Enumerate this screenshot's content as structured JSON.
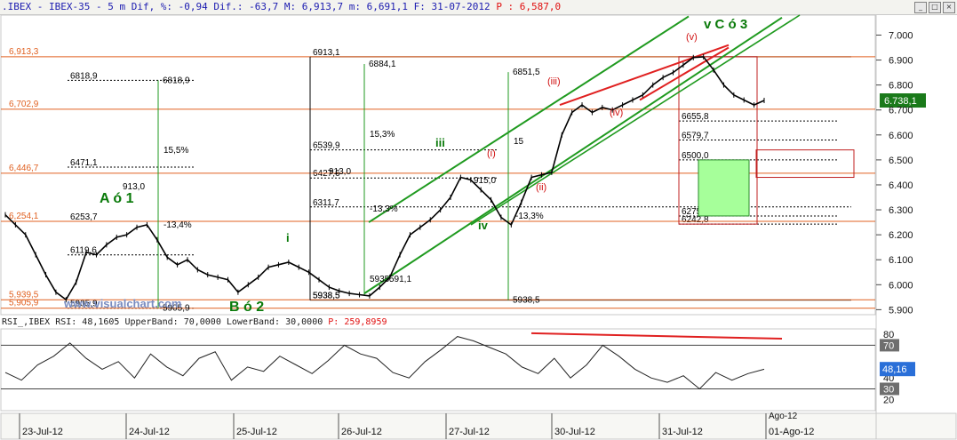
{
  "header": {
    "title": ".IBEX - IBEX-35 - 5 m Dif, %: -0,94 Dif.: -63,7 M: 6,913,7 m: 6,691,1 F: 31-07-2012",
    "price_label": "P : 6,587,0",
    "buttons": [
      "_",
      "□",
      "×"
    ]
  },
  "chart_data": [
    {
      "type": "line",
      "title": "IBEX-35 5 m",
      "x": [
        "23-Jul-12",
        "24-Jul-12",
        "25-Jul-12",
        "26-Jul-12",
        "27-Jul-12",
        "30-Jul-12",
        "31-Jul-12",
        "01-Ago-12"
      ],
      "ylim": [
        5880,
        7080
      ],
      "y_ticks": [
        "7.000",
        "6.900",
        "6.800",
        "6.700",
        "6.600",
        "6.500",
        "6.400",
        "6.300",
        "6.200",
        "6.100",
        "6.000",
        "5.900"
      ],
      "series": [
        {
          "values": [
            6280,
            6240,
            6200,
            6120,
            6040,
            5970,
            5940,
            6010,
            6130,
            6120,
            6160,
            6190,
            6200,
            6230,
            6240,
            6180,
            6110,
            6080,
            6100,
            6060,
            6040,
            6030,
            6020,
            5970,
            6000,
            6030,
            6070,
            6080,
            6090,
            6070,
            6050,
            6020,
            5990,
            5975,
            5965,
            5960,
            5955,
            5990,
            6030,
            6120,
            6200,
            6230,
            6260,
            6300,
            6350,
            6430,
            6420,
            6380,
            6340,
            6270,
            6240,
            6330,
            6430,
            6440,
            6450,
            6600,
            6690,
            6720,
            6690,
            6710,
            6700,
            6720,
            6740,
            6760,
            6800,
            6830,
            6850,
            6880,
            6910,
            6913,
            6860,
            6800,
            6760,
            6740,
            6720,
            6738
          ]
        }
      ],
      "current_value": "6.738,1",
      "left_price_labels": [
        "6,913,3",
        "6,702,9",
        "6,446,7",
        "6,254,1",
        "5,939,5",
        "5,905,9"
      ],
      "levels": [
        "6913,1",
        "6884,1",
        "6851,5",
        "6818,9",
        "6655,8",
        "6579,7",
        "6539,9",
        "6500,0",
        "6471,1",
        "6427,6",
        "6311,7",
        "6275,4",
        "6253,7",
        "6242,8",
        "6119,6",
        "5938,5",
        "5905,9"
      ],
      "annotations": [
        "A ó 1",
        "B ó 2",
        "v C ó 3",
        "i",
        "iii",
        "iv",
        "(i)",
        "(ii)",
        "(iii)",
        "(iv)",
        "(v)",
        "913,0",
        "15,5%",
        "-13,4%",
        "15,3%",
        "-13,3%",
        "-13,3%",
        "15",
        "913,0",
        "915,0",
        "5935",
        "591,1",
        "www.visualchart.com"
      ]
    },
    {
      "type": "line",
      "title": "RSI_,IBEX RSI",
      "series": [
        {
          "name": "RSI",
          "values": [
            45,
            38,
            52,
            60,
            72,
            58,
            48,
            55,
            40,
            62,
            50,
            42,
            58,
            64,
            38,
            50,
            46,
            60,
            52,
            44,
            56,
            70,
            62,
            58,
            45,
            40,
            55,
            66,
            78,
            74,
            68,
            62,
            50,
            44,
            58,
            40,
            52,
            70,
            60,
            48,
            40,
            36,
            42,
            30,
            45,
            38,
            44,
            48
          ]
        }
      ],
      "ylim": [
        10,
        85
      ],
      "y_ticks": [
        "80",
        "70",
        "40",
        "30",
        "20"
      ],
      "upper_band": "70,0000",
      "lower_band": "30,0000",
      "current_value": "48,16",
      "legend": "RSI_,IBEX RSI: 48,1605 UpperBand: 70,0000 LowerBand: 30,0000",
      "price_label": "P: 259,8959"
    }
  ],
  "x_axis": {
    "labels": [
      "23-Jul-12",
      "24-Jul-12",
      "25-Jul-12",
      "26-Jul-12",
      "27-Jul-12",
      "30-Jul-12",
      "31-Jul-12",
      "01-Ago-12"
    ],
    "extra_label": "Ago-12"
  },
  "colors": {
    "price_line": "#000000",
    "channel": "#1f9a1f",
    "wedge": "#e02020",
    "level_orange": "#e06020",
    "label_green": "#0a7a0a",
    "label_red": "#d01010",
    "rsi_blue": "#2a6fd8",
    "box_fill": "#a6ff9a"
  }
}
